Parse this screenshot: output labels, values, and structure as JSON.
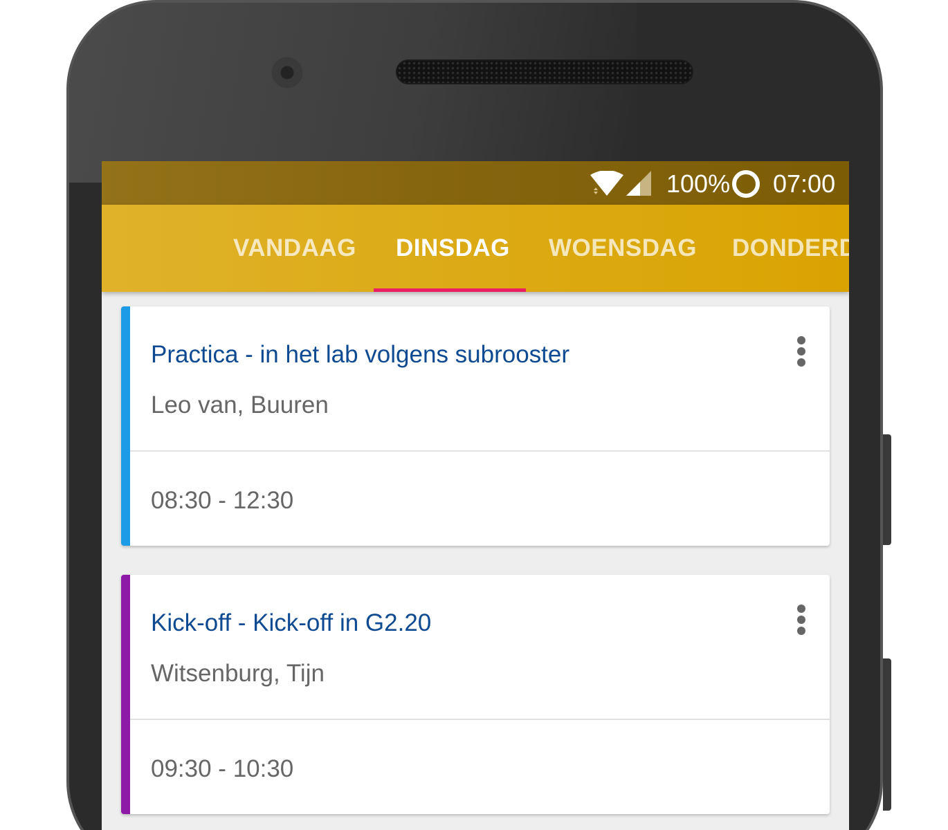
{
  "status_bar": {
    "battery_percent": "100%",
    "time": "07:00",
    "wifi_icon": "wifi-icon",
    "signal_icon": "cell-signal-icon",
    "battery_icon": "battery-ring-icon"
  },
  "tabs": [
    {
      "label": "VANDAAG",
      "active": false
    },
    {
      "label": "DINSDAG",
      "active": true
    },
    {
      "label": "WOENSDAG",
      "active": false
    },
    {
      "label": "DONDERD",
      "active": false
    }
  ],
  "colors": {
    "status_bar": "#86650f",
    "app_bar": "#dcaa15",
    "tab_indicator": "#e91e63",
    "title_text": "#0e4a91",
    "card1_accent": "#1e9be6",
    "card2_accent": "#8e1ba8"
  },
  "events": [
    {
      "title": "Practica - in het lab volgens subrooster",
      "person": "Leo van, Buuren",
      "time": "08:30 - 12:30",
      "menu_icon": "more-vert-icon"
    },
    {
      "title": "Kick-off - Kick-off in G2.20",
      "person": "Witsenburg, Tijn",
      "time": "09:30 - 10:30",
      "menu_icon": "more-vert-icon"
    }
  ]
}
